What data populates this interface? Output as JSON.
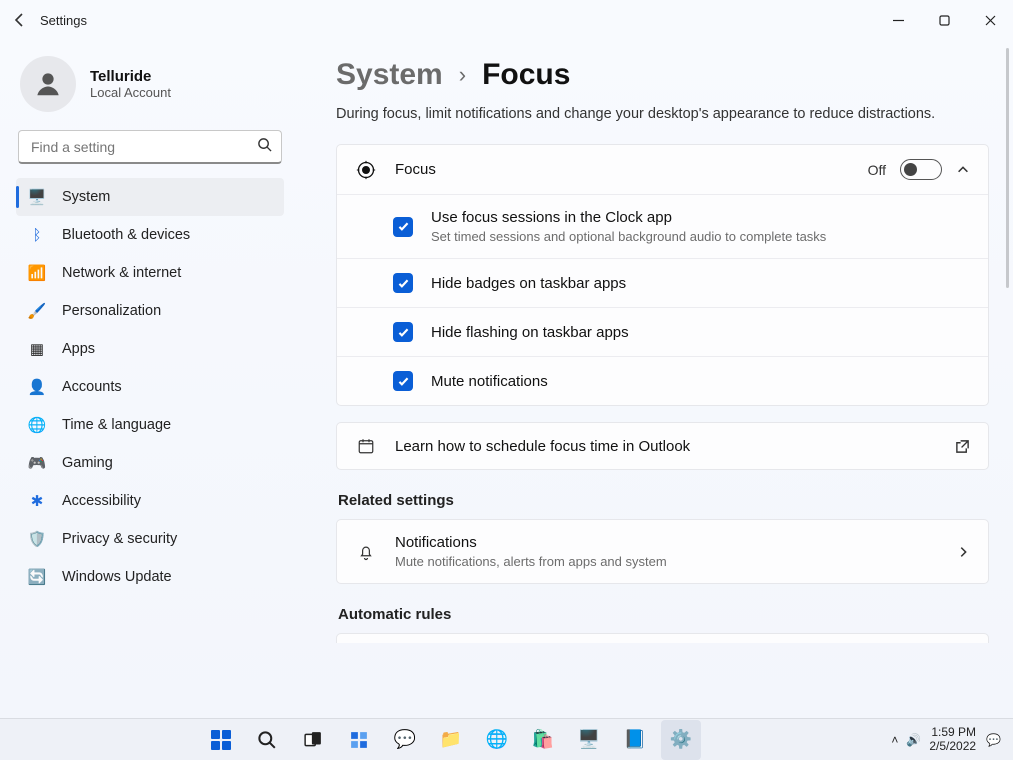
{
  "window": {
    "title": "Settings"
  },
  "account": {
    "name": "Telluride",
    "type": "Local Account"
  },
  "search": {
    "placeholder": "Find a setting"
  },
  "sidebar": {
    "items": [
      {
        "label": "System",
        "icon": "🖥️",
        "selected": true
      },
      {
        "label": "Bluetooth & devices",
        "icon": "ᛒ"
      },
      {
        "label": "Network & internet",
        "icon": "📶"
      },
      {
        "label": "Personalization",
        "icon": "🖌️"
      },
      {
        "label": "Apps",
        "icon": "▦"
      },
      {
        "label": "Accounts",
        "icon": "👤"
      },
      {
        "label": "Time & language",
        "icon": "🌐"
      },
      {
        "label": "Gaming",
        "icon": "🎮"
      },
      {
        "label": "Accessibility",
        "icon": "✱"
      },
      {
        "label": "Privacy & security",
        "icon": "🛡️"
      },
      {
        "label": "Windows Update",
        "icon": "🔄"
      }
    ]
  },
  "breadcrumb": {
    "parent": "System",
    "current": "Focus"
  },
  "description": "During focus, limit notifications and change your desktop's appearance to reduce distractions.",
  "focus": {
    "label": "Focus",
    "state_text": "Off",
    "options": [
      {
        "label": "Use focus sessions in the Clock app",
        "sub": "Set timed sessions and optional background audio to complete tasks",
        "checked": true
      },
      {
        "label": "Hide badges on taskbar apps",
        "checked": true
      },
      {
        "label": "Hide flashing on taskbar apps",
        "checked": true
      },
      {
        "label": "Mute notifications",
        "checked": true
      }
    ],
    "learn": "Learn how to schedule focus time in Outlook"
  },
  "related": {
    "heading": "Related settings",
    "notifications": {
      "label": "Notifications",
      "sub": "Mute notifications, alerts from apps and system"
    }
  },
  "automatic": {
    "heading": "Automatic rules"
  },
  "taskbar": {
    "time": "1:59 PM",
    "date": "2/5/2022"
  }
}
